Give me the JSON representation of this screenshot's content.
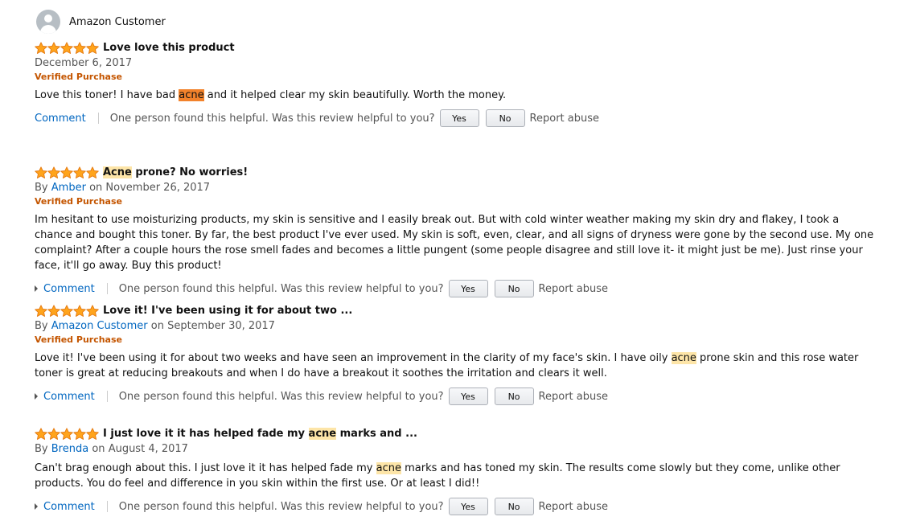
{
  "colors": {
    "star": "#ffa41c",
    "link": "#0066c0",
    "verified": "#c45500",
    "highlight": "#fde5a8",
    "highlight_strong": "#f2822b"
  },
  "top_profile": {
    "name": "Amazon Customer",
    "avatar_icon": "user-avatar-icon"
  },
  "reviews": [
    {
      "stars": 5,
      "title": [
        "",
        "Love love this product",
        ""
      ],
      "date": "December 6, 2017",
      "verified": "Verified Purchase",
      "body": [
        "Love this toner! I have bad ",
        "acne",
        " and it helped clear my skin beautifully. Worth the money."
      ],
      "comment_label": "Comment",
      "helpful_text": "One person found this helpful. Was this review helpful to you?",
      "yes_label": "Yes",
      "no_label": "No",
      "report_label": "Report abuse"
    },
    {
      "stars": 5,
      "title": [
        "",
        "Acne",
        " prone? No worries!"
      ],
      "by_prefix": "By",
      "author": "Amber",
      "date_prefix": "on",
      "date": "November 26, 2017",
      "verified": "Verified Purchase",
      "body": [
        "Im hesitant to use moisturizing products, my skin is sensitive and I easily break out. But with cold winter weather making my skin dry and flakey, I took a chance and bought this toner. By far, the best product I've ever used. My skin is soft, even, clear, and all signs of dryness were gone by the second use. My one complaint? After a couple hours the rose smell fades and becomes a little pungent (some people disagree and still love it- it might just be me). Just rinse your face, it'll go away. Buy this product!"
      ],
      "comment_label": "Comment",
      "helpful_text": "One person found this helpful. Was this review helpful to you?",
      "yes_label": "Yes",
      "no_label": "No",
      "report_label": "Report abuse"
    },
    {
      "stars": 5,
      "title": [
        "Love it! I've been using it for about two ...",
        "",
        ""
      ],
      "by_prefix": "By",
      "author": "Amazon Customer",
      "date_prefix": "on",
      "date": "September 30, 2017",
      "verified": "Verified Purchase",
      "body": [
        "Love it! I've been using it for about two weeks and have seen an improvement in the clarity of my face's skin. I have oily ",
        "acne",
        " prone skin and this rose water toner is great at reducing breakouts and when I do have a breakout it soothes the irritation and clears it well."
      ],
      "comment_label": "Comment",
      "helpful_text": "One person found this helpful. Was this review helpful to you?",
      "yes_label": "Yes",
      "no_label": "No",
      "report_label": "Report abuse"
    },
    {
      "stars": 5,
      "title": [
        "I just love it it has helped fade my ",
        "acne",
        " marks and ..."
      ],
      "by_prefix": "By",
      "author": "Brenda",
      "date_prefix": "on",
      "date": "August 4, 2017",
      "body": [
        "Can't brag enough about this. I just love it it has helped fade my ",
        "acne",
        " marks and has toned my skin. The results come slowly but they come, unlike other products. You do feel and difference in you skin within the first use. Or at least I did!!"
      ],
      "comment_label": "Comment",
      "helpful_text": "One person found this helpful. Was this review helpful to you?",
      "yes_label": "Yes",
      "no_label": "No",
      "report_label": "Report abuse"
    }
  ]
}
